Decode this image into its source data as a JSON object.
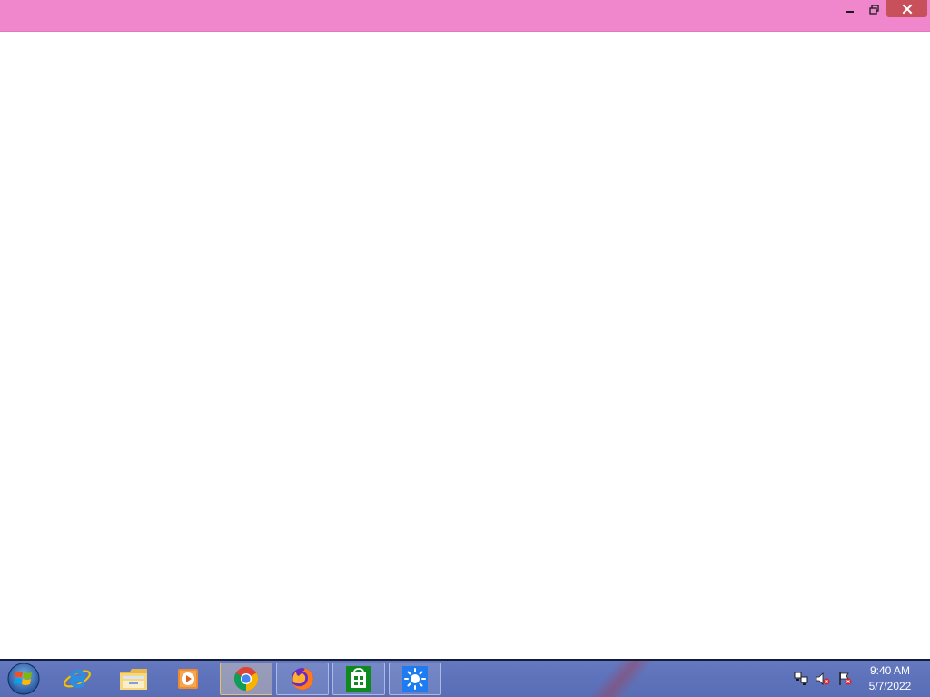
{
  "window": {
    "title_bar_color": "#f086cc",
    "buttons": {
      "minimize_icon": "minimize-icon",
      "restore_icon": "restore-icon",
      "close_icon": "close-icon",
      "close_color": "#c7505a"
    }
  },
  "taskbar": {
    "start_icon": "windows-logo-icon",
    "apps": [
      {
        "name": "Internet Explorer",
        "icon": "internet-explorer-icon",
        "state": "pinned"
      },
      {
        "name": "File Explorer",
        "icon": "folder-icon",
        "state": "pinned"
      },
      {
        "name": "Media Player",
        "icon": "media-player-icon",
        "state": "pinned"
      },
      {
        "name": "Google Chrome",
        "icon": "chrome-icon",
        "state": "active"
      },
      {
        "name": "Firefox",
        "icon": "firefox-icon",
        "state": "running"
      },
      {
        "name": "Store",
        "icon": "store-icon",
        "state": "running"
      },
      {
        "name": "Weather",
        "icon": "sun-icon",
        "state": "running"
      }
    ],
    "tray": {
      "icons": [
        "network-icon",
        "volume-muted-icon",
        "action-center-flag-icon"
      ],
      "time": "9:40 AM",
      "date": "5/7/2022"
    }
  }
}
